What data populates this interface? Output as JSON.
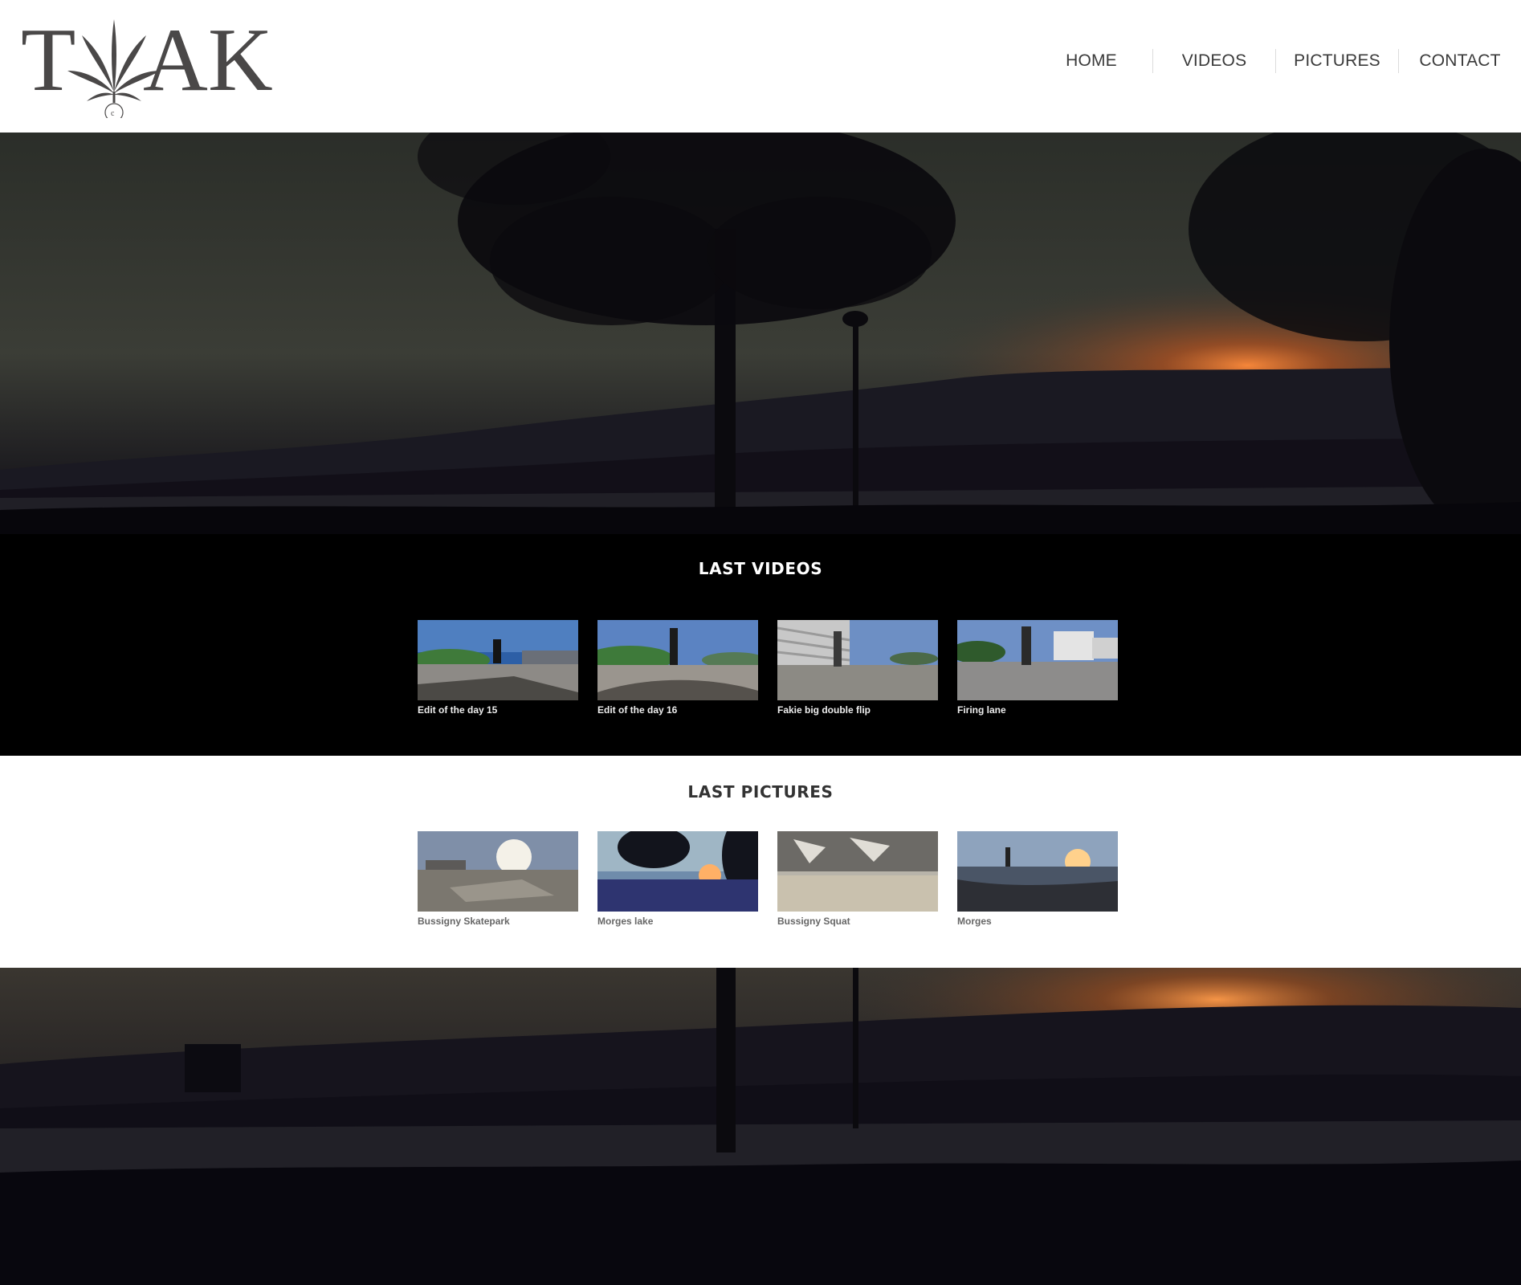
{
  "header": {
    "logo_text": "TAK",
    "nav": [
      {
        "label": "HOME"
      },
      {
        "label": "VIDEOS"
      },
      {
        "label": "PICTURES"
      },
      {
        "label": "CONTACT"
      }
    ]
  },
  "videos": {
    "title": "LAST VIDEOS",
    "items": [
      {
        "caption": "Edit of the day 15"
      },
      {
        "caption": "Edit of the day 16"
      },
      {
        "caption": "Fakie big double flip"
      },
      {
        "caption": "Firing lane"
      }
    ]
  },
  "pictures": {
    "title": "LAST PICTURES",
    "items": [
      {
        "caption": "Bussigny Skatepark"
      },
      {
        "caption": "Morges lake"
      },
      {
        "caption": "Bussigny Squat"
      },
      {
        "caption": "Morges"
      }
    ]
  },
  "colors": {
    "nav_text": "#3a3a3a",
    "logo": "#4a4848",
    "videos_bg": "#000000",
    "pictures_title": "#333333",
    "sun_glow": "#e0612a"
  }
}
